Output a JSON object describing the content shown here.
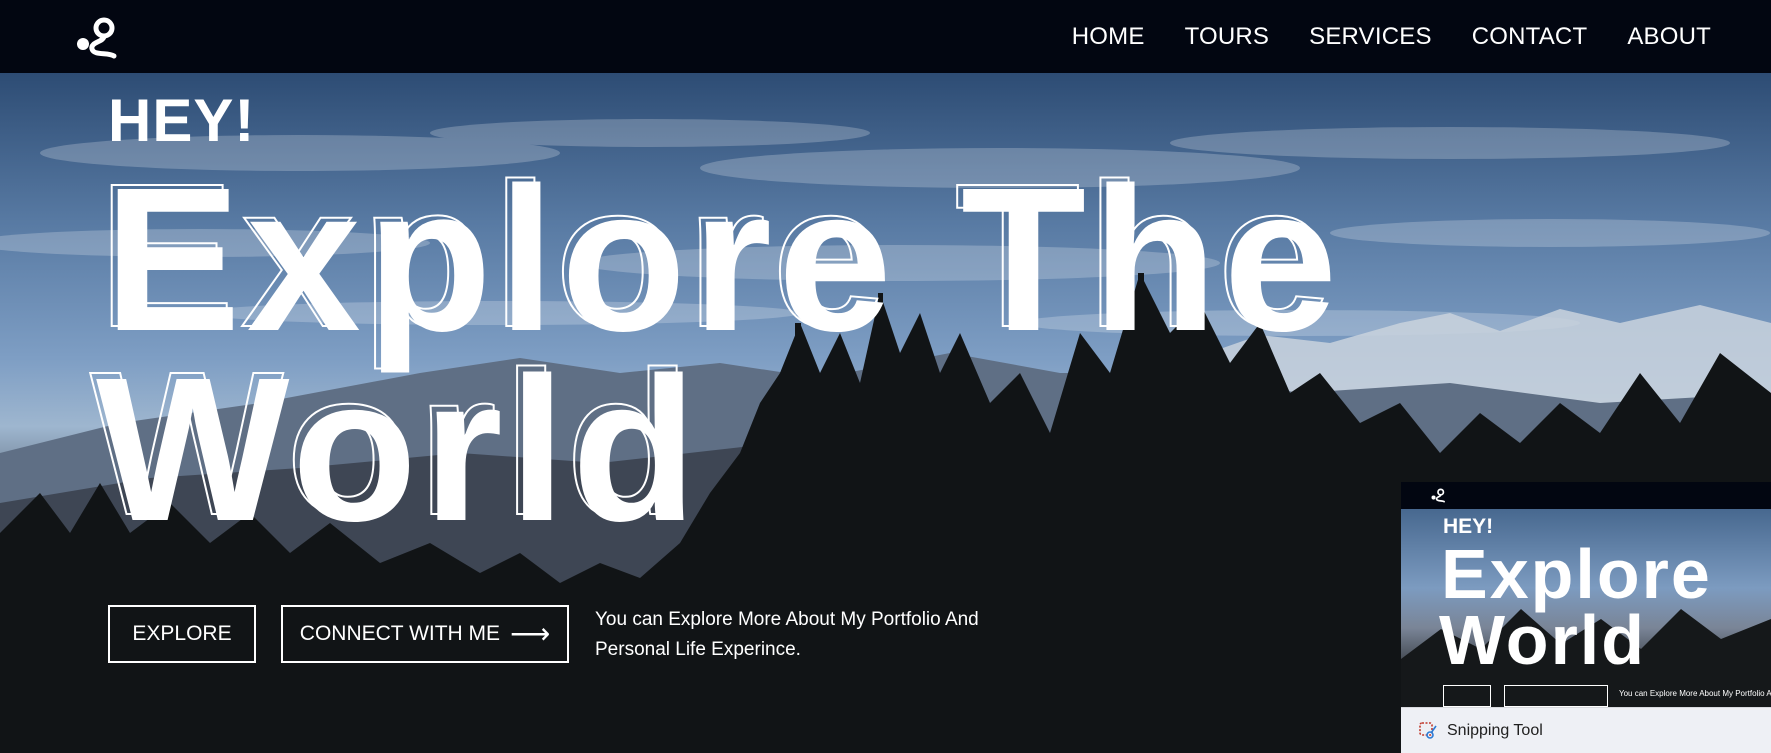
{
  "nav": {
    "logo_icon": "route-pin-icon",
    "links": [
      {
        "label": "HOME"
      },
      {
        "label": "TOURS"
      },
      {
        "label": "SERVICES"
      },
      {
        "label": "CONTACT"
      },
      {
        "label": "ABOUT"
      }
    ]
  },
  "hero": {
    "greeting": "HEY!",
    "headline_line1": "Explore The",
    "headline_line2": "World",
    "explore_button": "EXPLORE",
    "connect_button": "CONNECT WITH ME",
    "connect_arrow": "⟶",
    "tagline": "You can Explore More About My Portfolio And Personal Life Experince."
  },
  "preview": {
    "greeting": "HEY!",
    "headline_line1": "Explore",
    "headline_line2": "World",
    "tagline": "You can Explore More About My Portfolio And",
    "app_name": "Snipping Tool",
    "app_icon": "snipping-tool-icon"
  },
  "colors": {
    "nav_bg": "#020611",
    "text": "#ffffff",
    "taskbar_bg": "#eef0f5"
  }
}
